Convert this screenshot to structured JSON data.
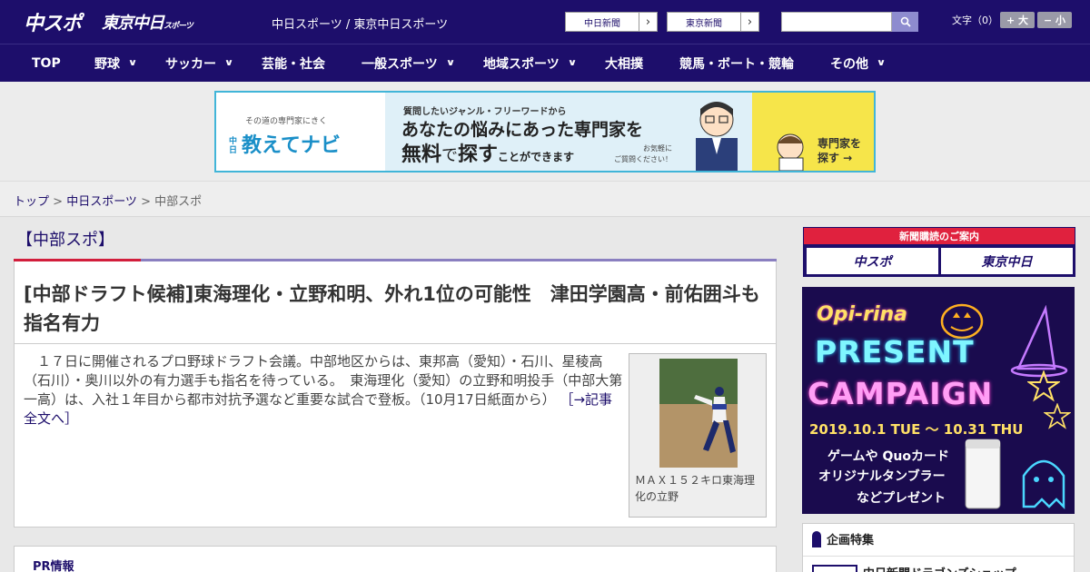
{
  "header": {
    "logo_chuspo": "中スポ",
    "logo_tokyo": "東京中日",
    "logo_tokyo_small": "スポーツ",
    "site_links": "中日スポーツ / 東京中日スポーツ",
    "btn_chunichi": "中日新聞",
    "btn_tokyo": "東京新聞",
    "search_placeholder": "",
    "fontsize_label": "文字（0）",
    "fontsize_big": "+ 大",
    "fontsize_small": "− 小"
  },
  "nav": [
    {
      "label": "TOP",
      "dropdown": false
    },
    {
      "label": "野球",
      "dropdown": true
    },
    {
      "label": "サッカー",
      "dropdown": true
    },
    {
      "label": "芸能・社会",
      "dropdown": false
    },
    {
      "label": "一般スポーツ",
      "dropdown": true
    },
    {
      "label": "地域スポーツ",
      "dropdown": true
    },
    {
      "label": "大相撲",
      "dropdown": false
    },
    {
      "label": "競馬・ボート・競輪",
      "dropdown": false
    },
    {
      "label": "その他",
      "dropdown": true
    }
  ],
  "ad": {
    "sub": "その道の専門家にきく",
    "brand_small": "中日",
    "brand": "教えてナビ",
    "line1": "質問したいジャンル・フリーワードから",
    "line2": "あなたの悩みにあった専門家を",
    "line3_a": "無料",
    "line3_b": "で",
    "line3_c": "探す",
    "line3_d": "ことができます",
    "note1": "お気軽に",
    "note2": "ご質問ください！",
    "cta1": "専門家を",
    "cta2": "探す →"
  },
  "breadcrumb": {
    "home": "トップ",
    "sep1": " > ",
    "section": "中日スポーツ",
    "sep2": " > ",
    "current": "中部スポ"
  },
  "section_title": "【中部スポ】",
  "article": {
    "headline": "[中部ドラフト候補]東海理化・立野和明、外れ1位の可能性　津田学園高・前佑囲斗も指名有力",
    "lead": "　１７日に開催されるプロ野球ドラフト会議。中部地区からは、東邦高（愛知）・石川、星稜高（石川）・奥川以外の有力選手も指名を待っている。　東海理化（愛知）の立野和明投手（中部大第一高）は、入社１年目から都市対抗予選など重要な試合で登板。（10月17日紙面から）",
    "more_link": "［→記事全文へ］",
    "photo_caption": "ＭＡＸ１５２キロ東海理化の立野"
  },
  "pr_label": "PR情報",
  "sidebar": {
    "subscribe_title": "新聞購読のご案内",
    "sub_chuspo": "中スポ",
    "sub_tokyo": "東京中日",
    "campaign": {
      "brand": "Opi-rina",
      "line1": "PRESENT",
      "line2": "CAMPAIGN",
      "dates": "2019.10.1 TUE 〜 10.31 THU",
      "gift1": "ゲームや Quoカード",
      "gift2": "オリジナルタンブラー",
      "gift3": "などプレゼント"
    },
    "feature_title": "企画特集",
    "feature_item": "中日新聞ドラゴンズショップ"
  },
  "colors": {
    "brand_navy": "#1d0e6b",
    "accent_red": "#d21e3c",
    "ad_border": "#41b5d8"
  }
}
